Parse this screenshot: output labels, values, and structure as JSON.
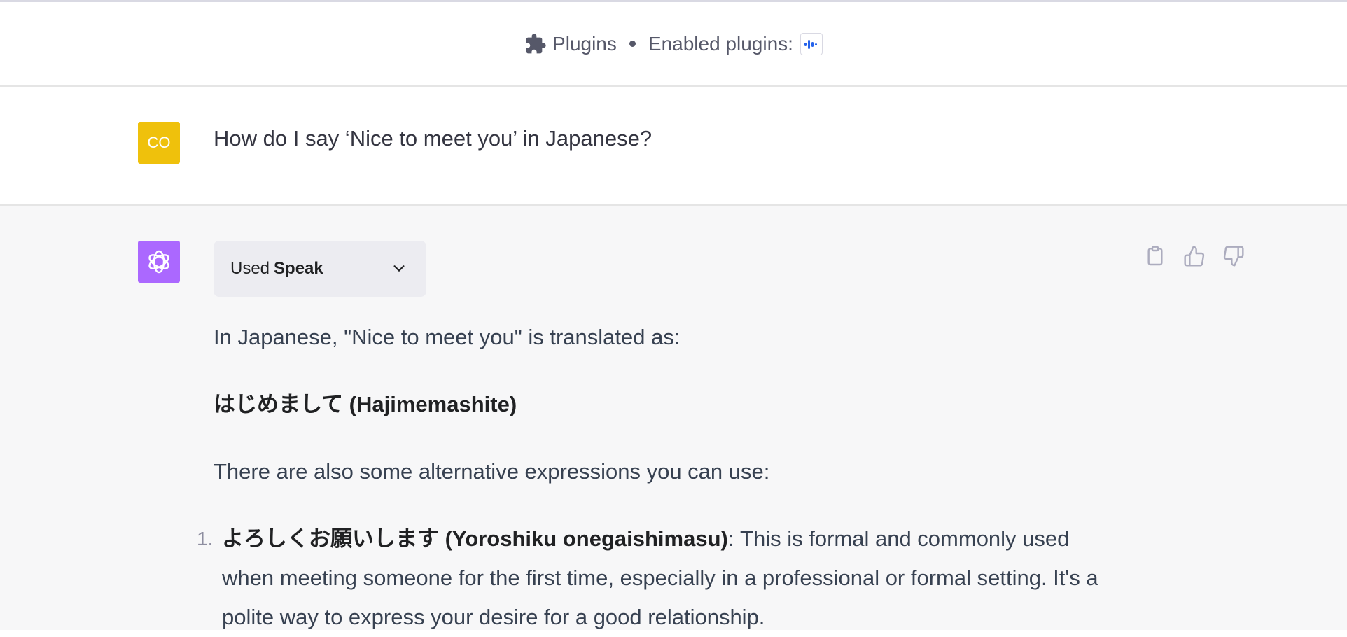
{
  "header": {
    "plugins_label": "Plugins",
    "enabled_label": "Enabled plugins:",
    "plugin_icon": "speak-logo-icon"
  },
  "user_message": {
    "avatar_initials": "CO",
    "avatar_color": "#efc10c",
    "text": "How do I say ‘Nice to meet you’ in Japanese?"
  },
  "assistant_message": {
    "avatar_color": "#ab68ff",
    "plugin_used": {
      "prefix": "Used",
      "name": "Speak"
    },
    "intro": "In Japanese, \"Nice to meet you\" is translated as:",
    "main_translation": "はじめまして (Hajimemashite)",
    "alternatives_intro": "There are also some alternative expressions you can use:",
    "list": [
      {
        "number": "1.",
        "term": "よろしくお願いします (Yoroshiku onegaishimasu)",
        "description": ": This is formal and commonly used when meeting someone for the first time, especially in a professional or formal setting. It's a polite way to express your desire for a good relationship."
      }
    ],
    "actions": [
      "copy-icon",
      "thumbs-up-icon",
      "thumbs-down-icon"
    ]
  },
  "colors": {
    "accent_blue": "#2563eb",
    "assistant_bg": "#f7f7f8"
  }
}
